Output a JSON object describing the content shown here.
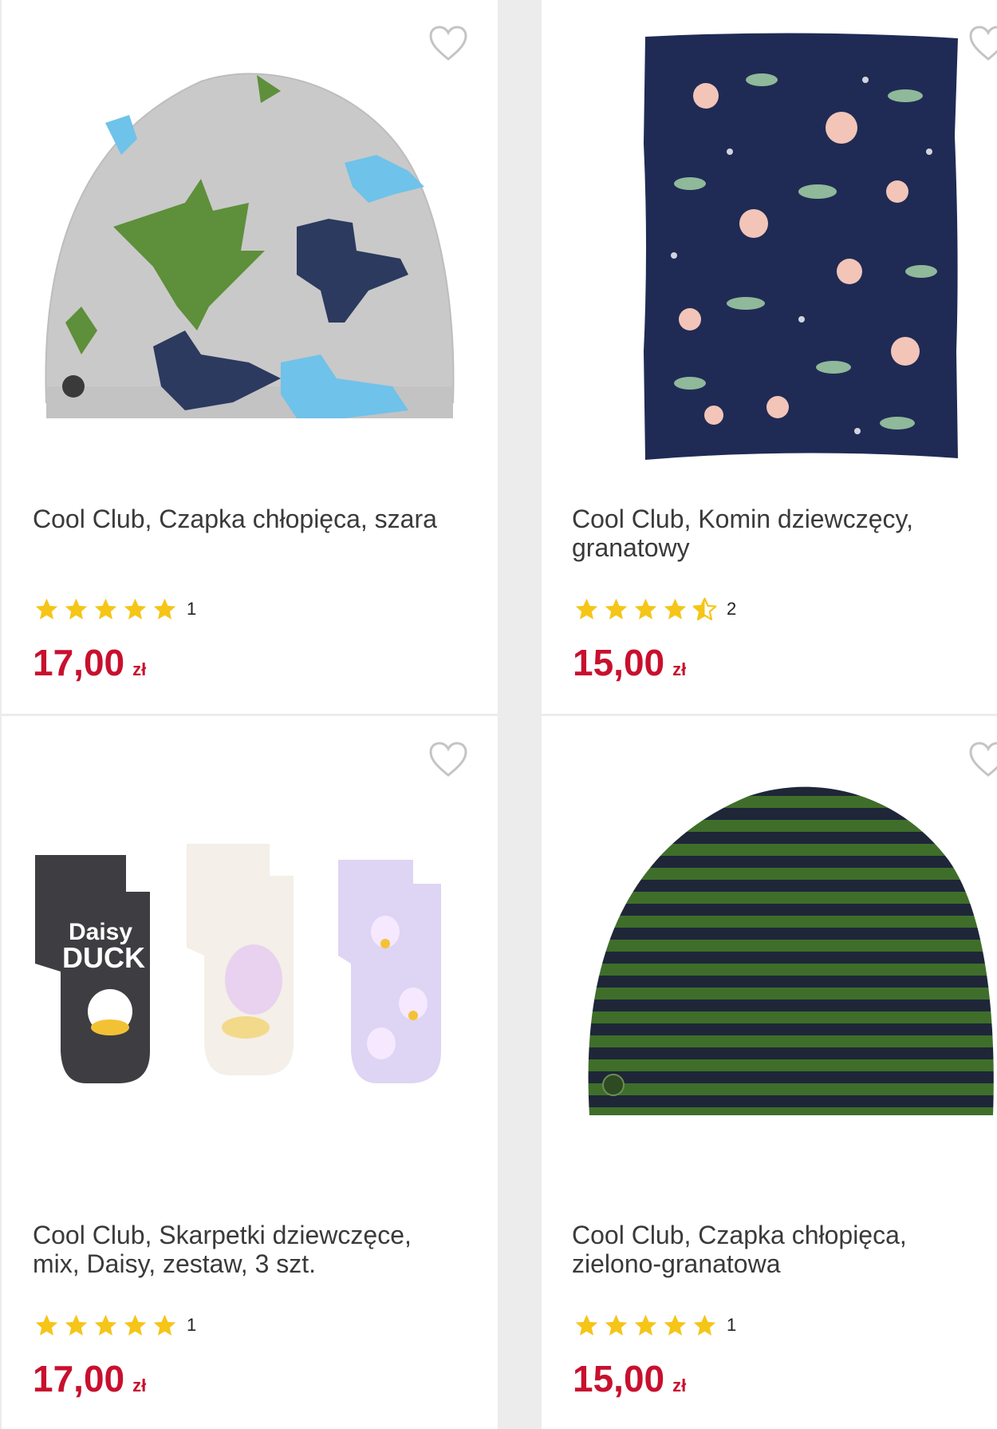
{
  "products": [
    {
      "title": "Cool Club, Czapka chłopięca, szara",
      "rating": 5,
      "review_count": "1",
      "price": "17,00",
      "currency": "zł",
      "image_icon": "gray-dinosaur-beanie-image"
    },
    {
      "title": "Cool Club, Komin dziewczęcy, granatowy",
      "rating": 4.5,
      "review_count": "2",
      "price": "15,00",
      "currency": "zł",
      "image_icon": "navy-floral-snood-image"
    },
    {
      "title": "Cool Club, Skarpetki dziewczęce, mix, Daisy, zestaw, 3 szt.",
      "rating": 5,
      "review_count": "1",
      "price": "17,00",
      "currency": "zł",
      "image_icon": "daisy-duck-socks-image",
      "image_text_1": "Daisy",
      "image_text_2": "DUCK"
    },
    {
      "title": "Cool Club, Czapka chłopięca, zielono-granatowa",
      "rating": 5,
      "review_count": "1",
      "price": "15,00",
      "currency": "zł",
      "image_icon": "green-navy-striped-beanie-image"
    }
  ],
  "colors": {
    "price": "#c8102e",
    "star": "#f5c518",
    "heart": "#c4c4c4",
    "background": "#ececec"
  }
}
